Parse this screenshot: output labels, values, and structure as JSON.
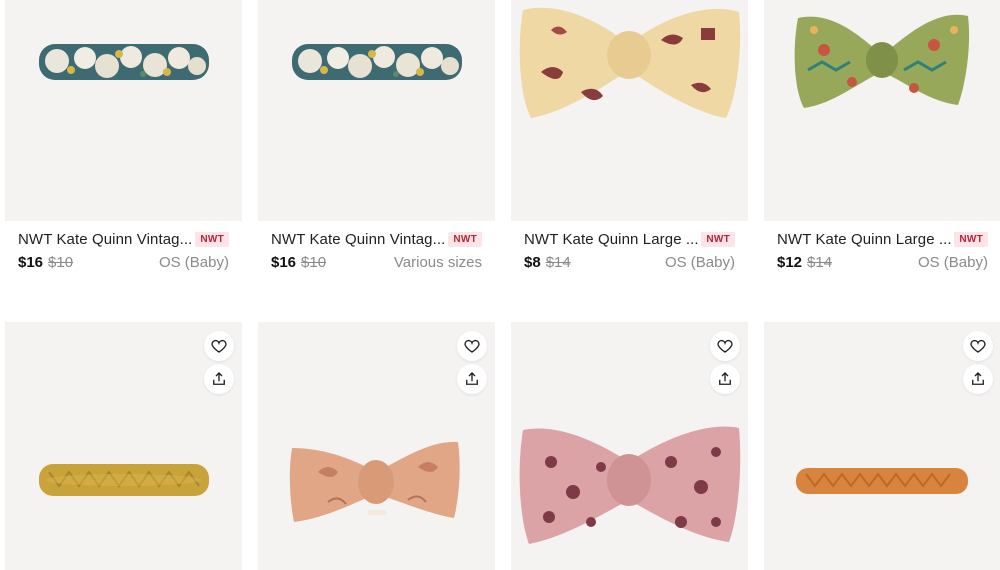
{
  "listings_row1": [
    {
      "title": "NWT Kate Quinn Vintag...",
      "badge": "NWT",
      "price": "$16",
      "original_price": "$10",
      "size": "OS (Baby)",
      "image": "blue-floral-braided-headband"
    },
    {
      "title": "NWT Kate Quinn Vintag...",
      "badge": "NWT",
      "price": "$16",
      "original_price": "$10",
      "size": "Various sizes",
      "image": "blue-floral-braided-headband"
    },
    {
      "title": "NWT Kate Quinn Large ...",
      "badge": "NWT",
      "price": "$8",
      "original_price": "$14",
      "size": "OS (Baby)",
      "image": "cream-maroon-bow-headband"
    },
    {
      "title": "NWT Kate Quinn Large ...",
      "badge": "NWT",
      "price": "$12",
      "original_price": "$14",
      "size": "OS (Baby)",
      "image": "green-floral-bow-headband"
    }
  ],
  "listings_row2": [
    {
      "image": "mustard-braided-headband",
      "icons": [
        "heart-icon",
        "share-icon"
      ]
    },
    {
      "image": "peach-knot-headband",
      "icons": [
        "heart-icon",
        "share-icon"
      ]
    },
    {
      "image": "pink-damask-bow-headband",
      "icons": [
        "heart-icon",
        "share-icon"
      ]
    },
    {
      "image": "orange-braided-headband",
      "icons": [
        "heart-icon",
        "share-icon"
      ]
    }
  ],
  "colors": {
    "image_bg": "#f4f3f2",
    "badge_text": "#b3263a",
    "badge_bg": "#fde4e7",
    "muted_text": "#8a8a8a"
  }
}
